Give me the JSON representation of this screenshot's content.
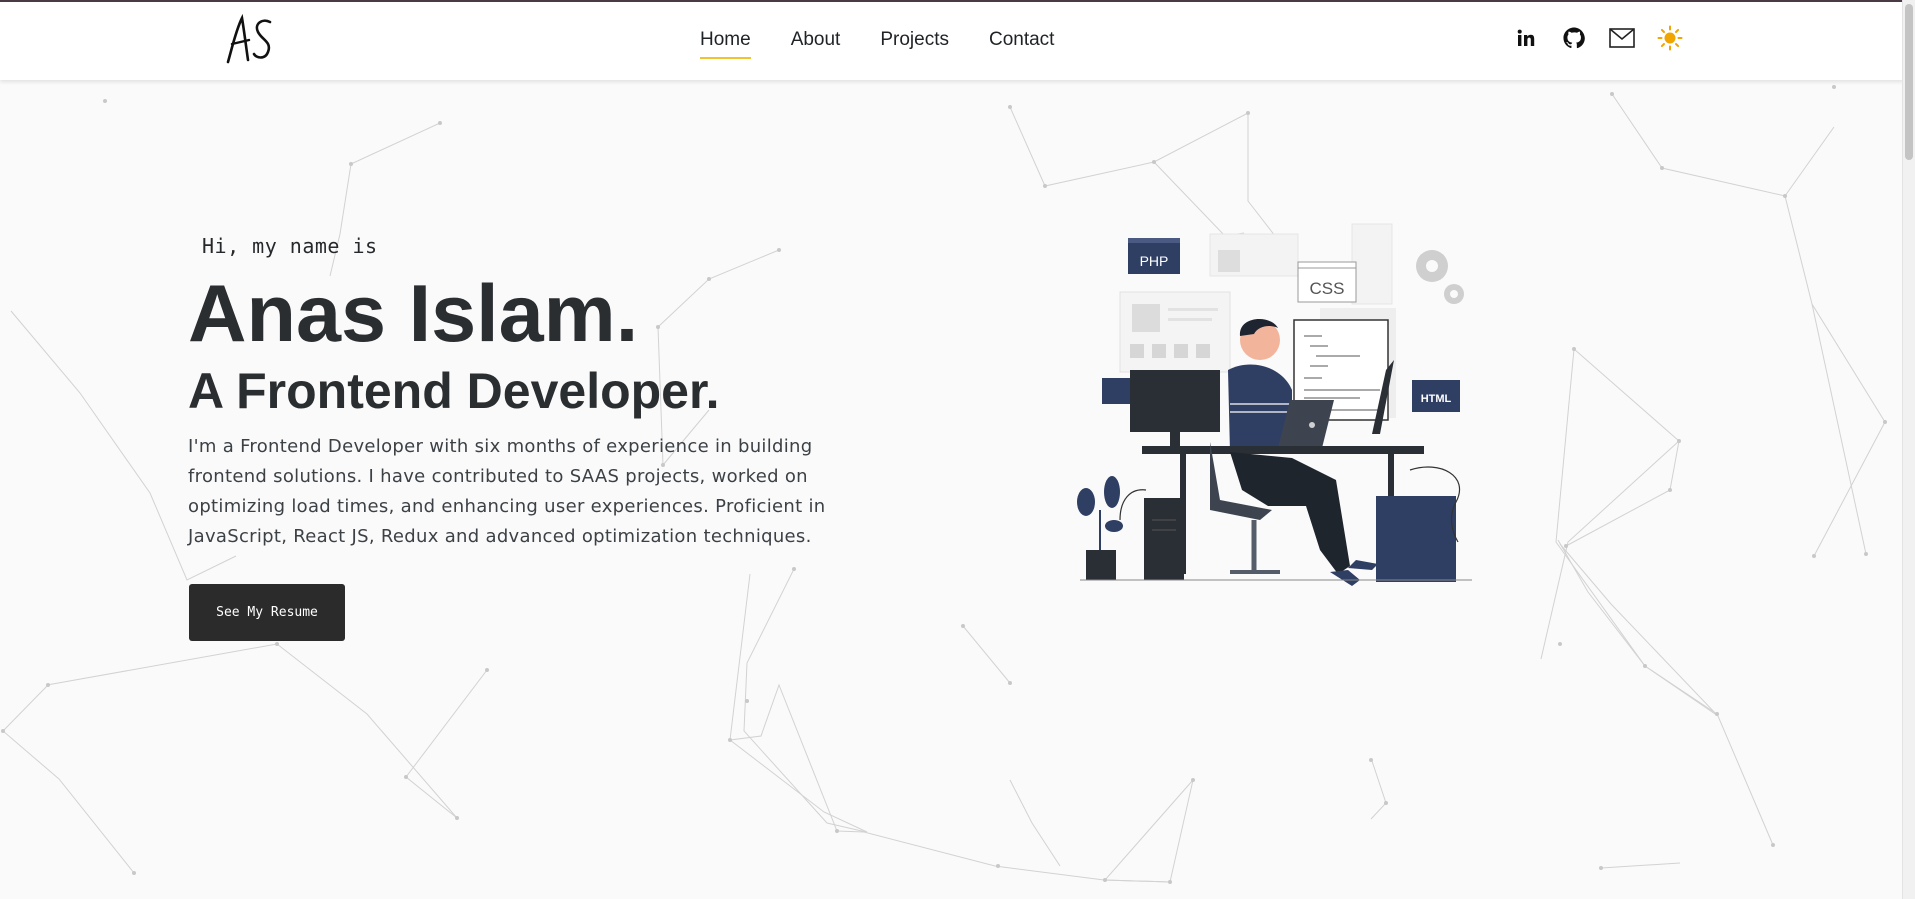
{
  "header": {
    "logo_text": "AS",
    "nav": [
      {
        "label": "Home",
        "active": true
      },
      {
        "label": "About",
        "active": false
      },
      {
        "label": "Projects",
        "active": false
      },
      {
        "label": "Contact",
        "active": false
      }
    ],
    "social_icons": [
      "linkedin-icon",
      "github-icon",
      "mail-icon",
      "sun-icon"
    ]
  },
  "hero": {
    "greeting": "Hi, my name is",
    "name": "Anas Islam.",
    "role": "A Frontend Developer.",
    "bio": "I'm a Frontend Developer with six months of experience in building frontend solutions. I have contributed to SAAS projects, worked on optimizing load times, and enhancing user experiences. Proficient in JavaScript, React JS, Redux and advanced optimization techniques.",
    "resume_button": "See My Resume"
  },
  "illustration": {
    "labels": {
      "php": "PHP",
      "css": "CSS",
      "html": "HTML"
    }
  },
  "colors": {
    "accent": "#f2c230",
    "text_dark": "#2a2e31",
    "button_bg": "#2b2b2b",
    "illustration_navy": "#2f3e63",
    "sun": "#f0a500"
  }
}
